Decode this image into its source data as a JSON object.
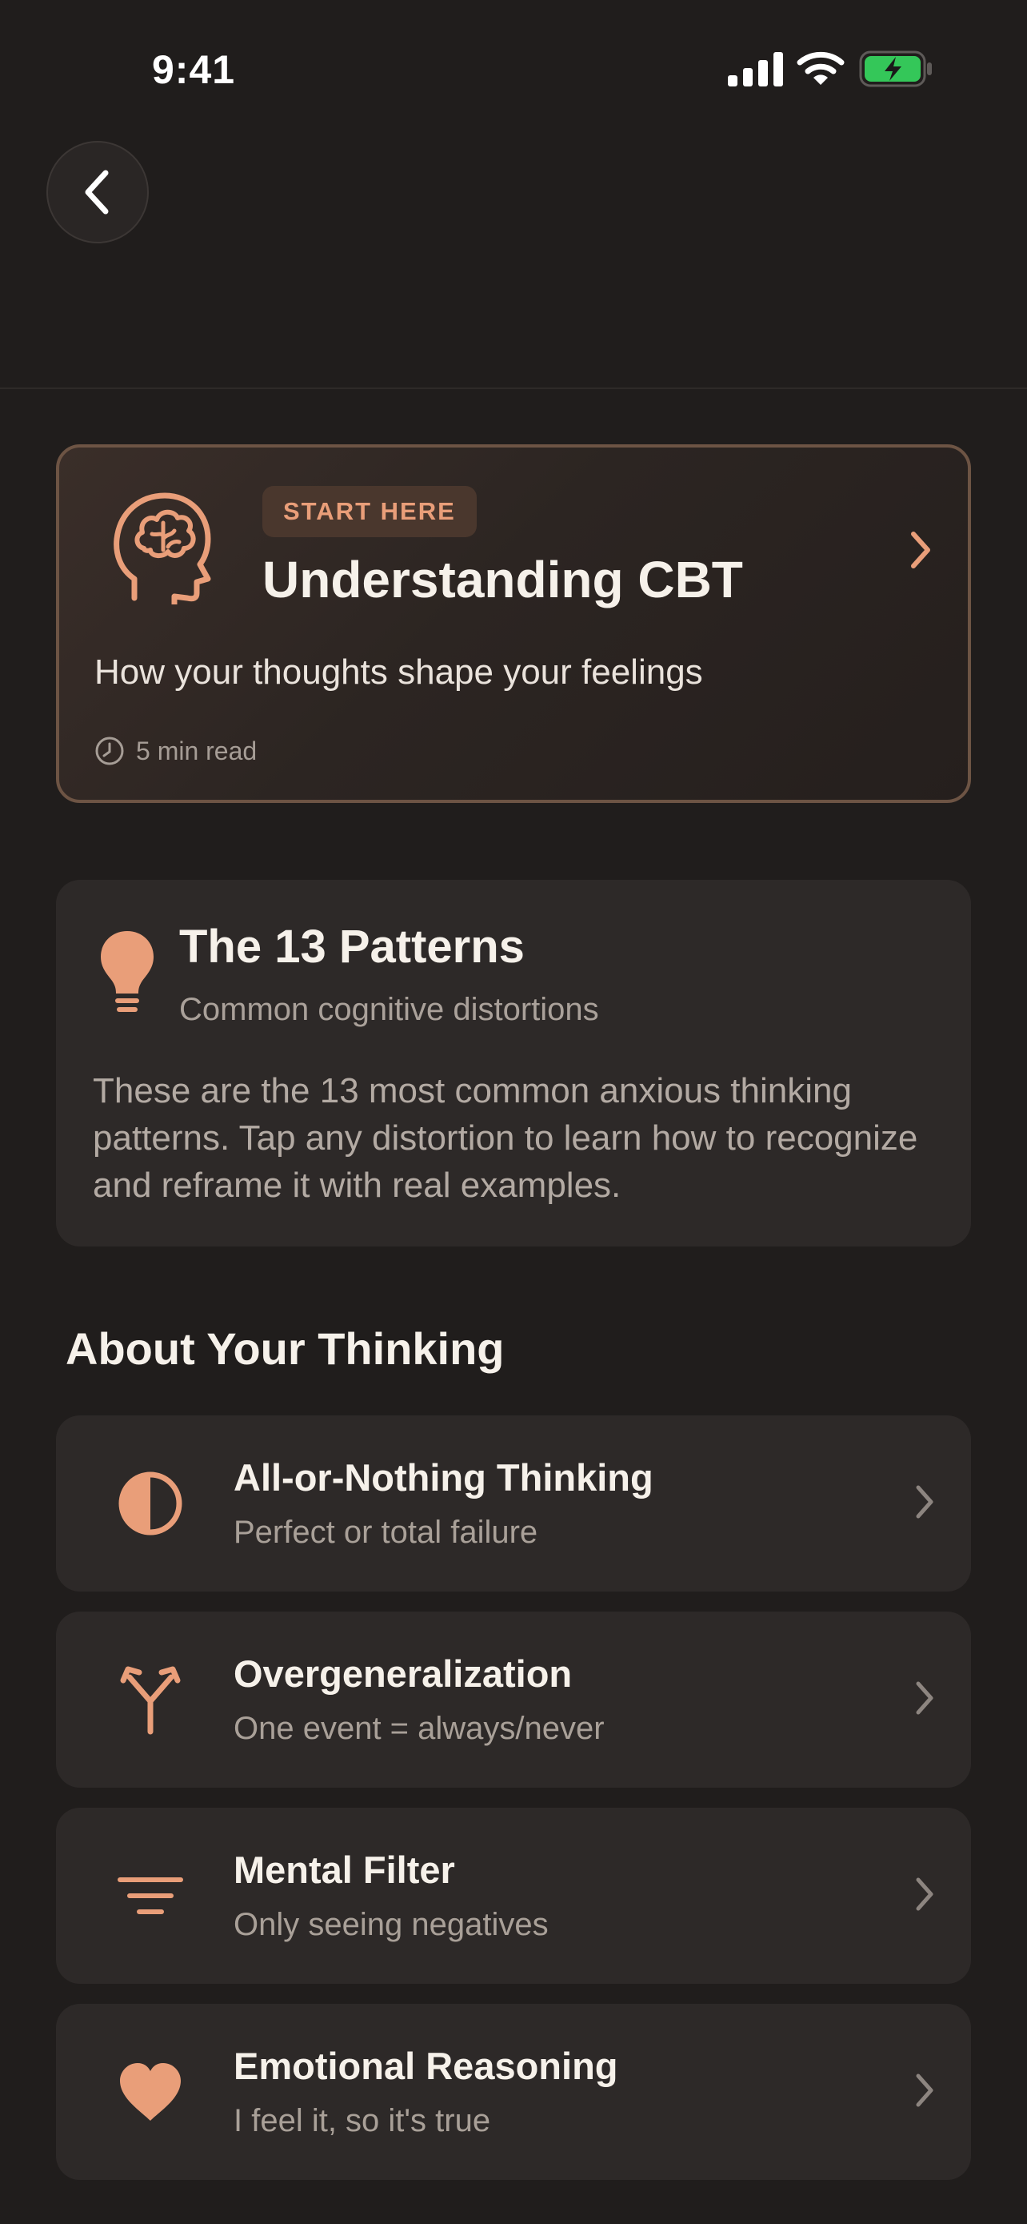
{
  "status_bar": {
    "time": "9:41"
  },
  "nav": {
    "back_icon": "chevron-left-icon"
  },
  "intro_card": {
    "icon": "brain-head-icon",
    "badge": "START HERE",
    "title": "Understanding CBT",
    "subtitle": "How your thoughts shape your feelings",
    "read_time": "5 min read"
  },
  "patterns_card": {
    "icon": "lightbulb-icon",
    "title": "The 13 Patterns",
    "subtitle": "Common cognitive distortions",
    "description": "These are the 13 most common anxious thinking patterns. Tap any distortion to learn how to recognize and reframe it with real examples."
  },
  "section": {
    "heading": "About Your Thinking"
  },
  "distortions": [
    {
      "icon": "half-circle-icon",
      "title": "All-or-Nothing Thinking",
      "subtitle": "Perfect or total failure"
    },
    {
      "icon": "branch-arrows-icon",
      "title": "Overgeneralization",
      "subtitle": "One event = always/never"
    },
    {
      "icon": "filter-lines-icon",
      "title": "Mental Filter",
      "subtitle": "Only seeing negatives"
    },
    {
      "icon": "heart-icon",
      "title": "Emotional Reasoning",
      "subtitle": "I feel it, so it's true"
    }
  ],
  "colors": {
    "background": "#201d1c",
    "card": "#2d2928",
    "accent": "#e99e79",
    "battery": "#34c759"
  }
}
